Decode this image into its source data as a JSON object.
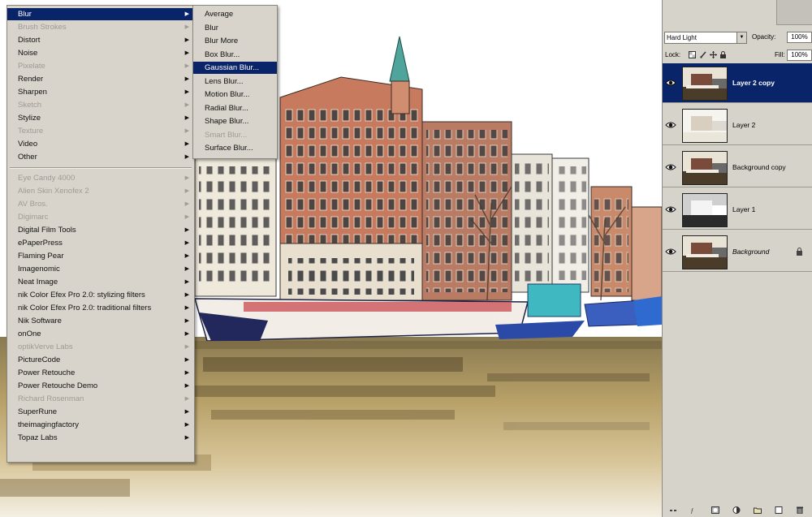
{
  "filter_menu": {
    "items": [
      {
        "label": "Blur",
        "state": "selected",
        "submenu": true
      },
      {
        "label": "Brush Strokes",
        "state": "disabled",
        "submenu": true
      },
      {
        "label": "Distort",
        "state": "normal",
        "submenu": true
      },
      {
        "label": "Noise",
        "state": "normal",
        "submenu": true
      },
      {
        "label": "Pixelate",
        "state": "disabled",
        "submenu": true
      },
      {
        "label": "Render",
        "state": "normal",
        "submenu": true
      },
      {
        "label": "Sharpen",
        "state": "normal",
        "submenu": true
      },
      {
        "label": "Sketch",
        "state": "disabled",
        "submenu": true
      },
      {
        "label": "Stylize",
        "state": "normal",
        "submenu": true
      },
      {
        "label": "Texture",
        "state": "disabled",
        "submenu": true
      },
      {
        "label": "Video",
        "state": "normal",
        "submenu": true
      },
      {
        "label": "Other",
        "state": "normal",
        "submenu": true
      },
      {
        "sep": true
      },
      {
        "label": "Eye Candy 4000",
        "state": "disabled",
        "submenu": true
      },
      {
        "label": "Alien Skin Xenofex 2",
        "state": "disabled",
        "submenu": true
      },
      {
        "label": "AV Bros.",
        "state": "disabled",
        "submenu": true
      },
      {
        "label": "Digimarc",
        "state": "disabled",
        "submenu": true
      },
      {
        "label": "Digital Film Tools",
        "state": "normal",
        "submenu": true
      },
      {
        "label": "ePaperPress",
        "state": "normal",
        "submenu": true
      },
      {
        "label": "Flaming Pear",
        "state": "normal",
        "submenu": true
      },
      {
        "label": "Imagenomic",
        "state": "normal",
        "submenu": true
      },
      {
        "label": "Neat Image",
        "state": "normal",
        "submenu": true
      },
      {
        "label": "nik Color Efex Pro 2.0: stylizing filters",
        "state": "normal",
        "submenu": true
      },
      {
        "label": "nik Color Efex Pro 2.0: traditional filters",
        "state": "normal",
        "submenu": true
      },
      {
        "label": "Nik Software",
        "state": "normal",
        "submenu": true
      },
      {
        "label": "onOne",
        "state": "normal",
        "submenu": true
      },
      {
        "label": "optikVerve Labs",
        "state": "disabled",
        "submenu": true
      },
      {
        "label": "PictureCode",
        "state": "normal",
        "submenu": true
      },
      {
        "label": "Power Retouche",
        "state": "normal",
        "submenu": true
      },
      {
        "label": "Power Retouche Demo",
        "state": "normal",
        "submenu": true
      },
      {
        "label": "Richard Rosenman",
        "state": "disabled",
        "submenu": true
      },
      {
        "label": "SuperRune",
        "state": "normal",
        "submenu": true
      },
      {
        "label": "theimagingfactory",
        "state": "normal",
        "submenu": true
      },
      {
        "label": "Topaz Labs",
        "state": "normal",
        "submenu": true
      }
    ]
  },
  "blur_submenu": {
    "items": [
      {
        "label": "Average",
        "state": "normal"
      },
      {
        "label": "Blur",
        "state": "normal"
      },
      {
        "label": "Blur More",
        "state": "normal"
      },
      {
        "label": "Box Blur...",
        "state": "normal"
      },
      {
        "label": "Gaussian Blur...",
        "state": "selected"
      },
      {
        "label": "Lens Blur...",
        "state": "normal"
      },
      {
        "label": "Motion Blur...",
        "state": "normal"
      },
      {
        "label": "Radial Blur...",
        "state": "normal"
      },
      {
        "label": "Shape Blur...",
        "state": "normal"
      },
      {
        "label": "Smart Blur...",
        "state": "disabled"
      },
      {
        "label": "Surface Blur...",
        "state": "normal"
      }
    ]
  },
  "layers_panel": {
    "blend_mode": "Hard Light",
    "opacity_label": "Opacity:",
    "opacity_value": "100%",
    "lock_label": "Lock:",
    "fill_label": "Fill:",
    "fill_value": "100%",
    "layers": [
      {
        "name": "Layer 2 copy",
        "active": true,
        "italic": false,
        "locked": false,
        "thumb": "dark-color"
      },
      {
        "name": "Layer 2",
        "active": false,
        "italic": false,
        "locked": false,
        "thumb": "pale-sketch"
      },
      {
        "name": "Background copy",
        "active": false,
        "italic": false,
        "locked": false,
        "thumb": "dark-color"
      },
      {
        "name": "Layer 1",
        "active": false,
        "italic": false,
        "locked": false,
        "thumb": "gray-inverted"
      },
      {
        "name": "Background",
        "active": false,
        "italic": true,
        "locked": true,
        "thumb": "dark-color"
      }
    ]
  },
  "colors": {
    "menu_bg": "#d8d4cc",
    "selection": "#0a246a",
    "disabled_text": "#9e9b94",
    "panel_bg": "#d6d3cb"
  }
}
